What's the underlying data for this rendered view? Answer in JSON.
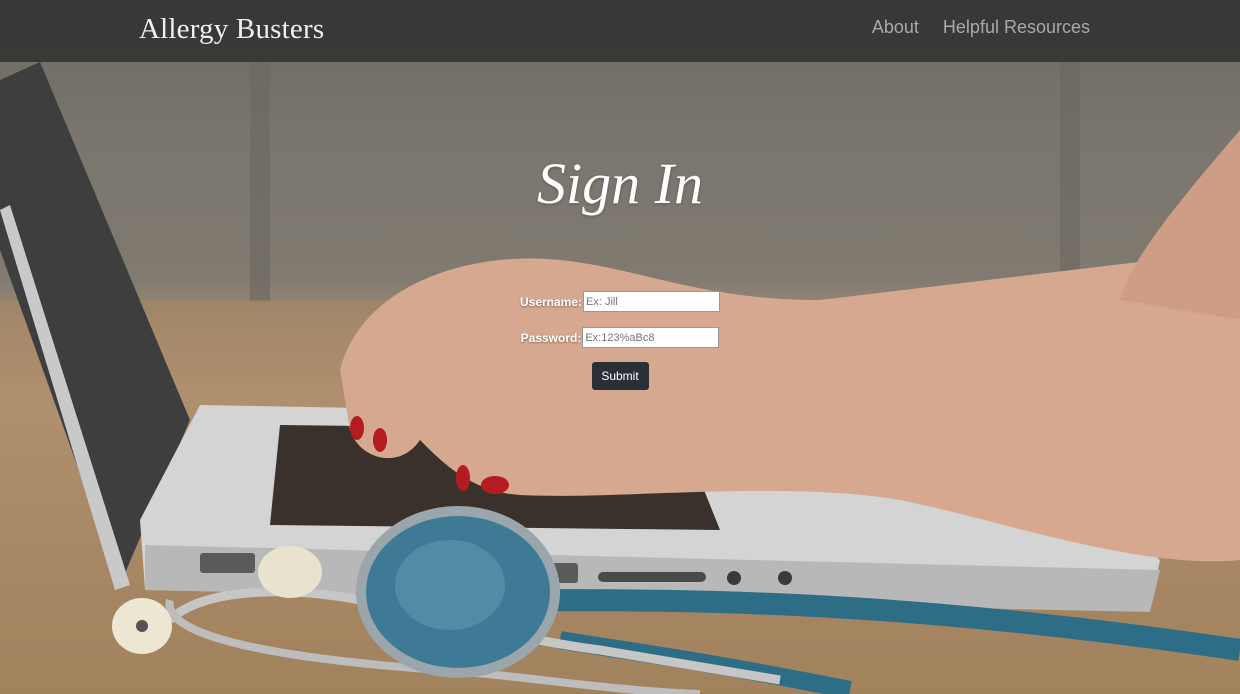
{
  "navbar": {
    "brand": "Allergy Busters",
    "links": [
      {
        "label": "About"
      },
      {
        "label": "Helpful Resources"
      }
    ]
  },
  "signin": {
    "title": "Sign In",
    "username_label": "Username:",
    "username_placeholder": "Ex: Jill",
    "password_label": "Password:",
    "password_placeholder": "Ex:123%aBc8",
    "submit_label": "Submit"
  },
  "colors": {
    "navbar_bg": "#343434",
    "brand_text": "#efefef",
    "nav_link_text": "#a9a9a9",
    "submit_bg": "#2b2f36"
  }
}
